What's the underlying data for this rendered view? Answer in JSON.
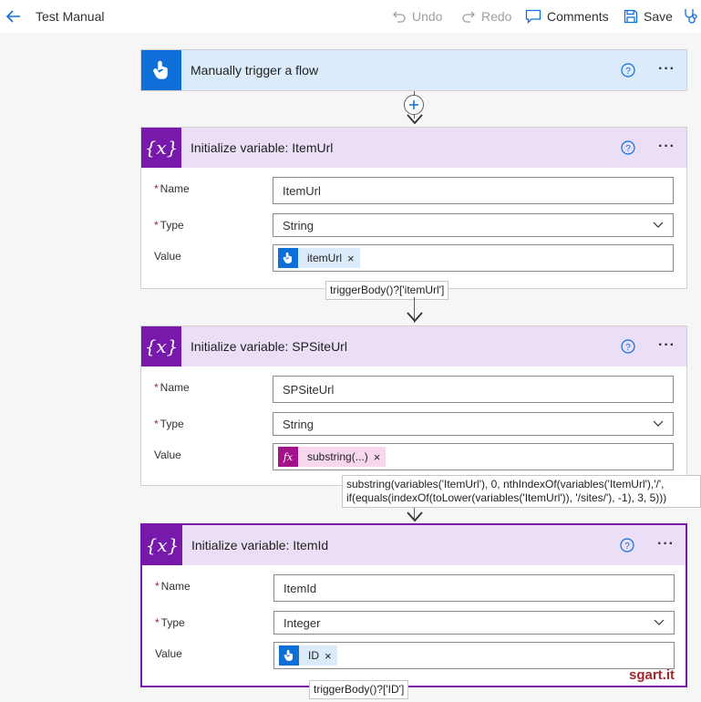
{
  "app": {
    "title": "Test Manual"
  },
  "toolbar": {
    "undo_label": "Undo",
    "redo_label": "Redo",
    "comments_label": "Comments",
    "save_label": "Save"
  },
  "trigger": {
    "title": "Manually trigger a flow",
    "icon": "touch-icon",
    "color": "#0f6fd8"
  },
  "cards": [
    {
      "title": "Initialize variable: ItemUrl",
      "name_label": "Name",
      "name_value": "ItemUrl",
      "type_label": "Type",
      "type_value": "String",
      "value_label": "Value",
      "token_label": "itemUrl",
      "token_kind": "touch-icon",
      "tooltip": "triggerBody()?['itemUrl']"
    },
    {
      "title": "Initialize variable: SPSiteUrl",
      "name_label": "Name",
      "name_value": "SPSiteUrl",
      "type_label": "Type",
      "type_value": "String",
      "value_label": "Value",
      "token_label": "substring(...)",
      "token_kind": "fx-icon",
      "tooltip_line1": "substring(variables('ItemUrl'), 0, nthIndexOf(variables('ItemUrl'),'/',",
      "tooltip_line2": "if(equals(indexOf(toLower(variables('ItemUrl')), '/sites/'), -1), 3, 5)))"
    },
    {
      "title": "Initialize variable: ItemId",
      "name_label": "Name",
      "name_value": "ItemId",
      "type_label": "Type",
      "type_value": "Integer",
      "value_label": "Value",
      "token_label": "ID",
      "token_kind": "touch-icon",
      "tooltip": "triggerBody()?['ID']"
    }
  ],
  "variable_icon_text": "{x}",
  "fx_icon_text": "fx",
  "required_mark": "*",
  "token_remove": "×",
  "more_label": "···",
  "watermark": "sgart.it",
  "colors": {
    "accent_purple": "#7719aa",
    "trigger_blue": "#0f6fd8",
    "header_purple_bg": "#eadff7",
    "header_blue_bg": "#dbebfb",
    "function_magenta": "#a4128a"
  }
}
